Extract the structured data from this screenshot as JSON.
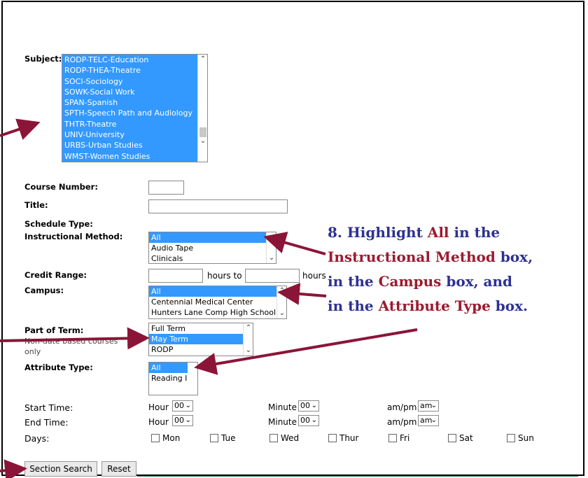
{
  "form": {
    "subject": {
      "label": "Subject:",
      "options": [
        "RODP-TELC-Education",
        "RODP-THEA-Theatre",
        "SOCI-Sociology",
        "SOWK-Social Work",
        "SPAN-Spanish",
        "SPTH-Speech Path and Audiology",
        "THTR-Theatre",
        "UNIV-University",
        "URBS-Urban Studies",
        "WMST-Women Studies"
      ]
    },
    "course_number": {
      "label": "Course Number:",
      "value": ""
    },
    "title": {
      "label": "Title:",
      "value": ""
    },
    "schedule_type": {
      "label": "Schedule Type:"
    },
    "instructional_method": {
      "label": "Instructional Method:",
      "options": [
        "All",
        "Audio Tape",
        "Clinicals"
      ],
      "selected": "All"
    },
    "credit_range": {
      "label": "Credit Range:",
      "mid_text": "hours to",
      "end_text": "hours"
    },
    "campus": {
      "label": "Campus:",
      "options": [
        "All",
        "Centennial Medical Center",
        "Hunters Lane Comp High School"
      ],
      "selected": "All"
    },
    "part_of_term": {
      "label": "Part of Term:",
      "note": "Non-date based courses only",
      "note_line1": "Non-date based courses",
      "note_line2": "only",
      "options": [
        "Full Term",
        "May Term",
        "RODP"
      ],
      "selected": "May Term"
    },
    "attribute_type": {
      "label": "Attribute Type:",
      "options": [
        "All",
        "Reading I"
      ],
      "selected": "All"
    },
    "start_time": {
      "label": "Start Time:",
      "hour_label": "Hour",
      "hour": "00",
      "minute_label": "Minute",
      "minute": "00",
      "ampm_label": "am/pm",
      "ampm": "am"
    },
    "end_time": {
      "label": "End Time:",
      "hour_label": "Hour",
      "hour": "00",
      "minute_label": "Minute",
      "minute": "00",
      "ampm_label": "am/pm",
      "ampm": "am"
    },
    "days": {
      "label": "Days:",
      "items": [
        "Mon",
        "Tue",
        "Wed",
        "Thur",
        "Fri",
        "Sat",
        "Sun"
      ]
    },
    "buttons": {
      "search": "Section Search",
      "reset": "Reset"
    }
  },
  "annotation": {
    "line1_prefix": "8.  Highlight ",
    "line1_red": "All",
    "line1_suffix": " in the",
    "line2_red": "Instructional Method",
    "line2_suffix": " box,",
    "line3_prefix": "in the ",
    "line3_red": "Campus",
    "line3_suffix": " box, and",
    "line4_prefix": "in the ",
    "line4_red": "Attribute Type",
    "line4_suffix": " box."
  },
  "colors": {
    "highlight": "#3399ff",
    "annotation_blue": "#2e3192",
    "annotation_red": "#9b1b30",
    "arrow": "#8b1538"
  }
}
